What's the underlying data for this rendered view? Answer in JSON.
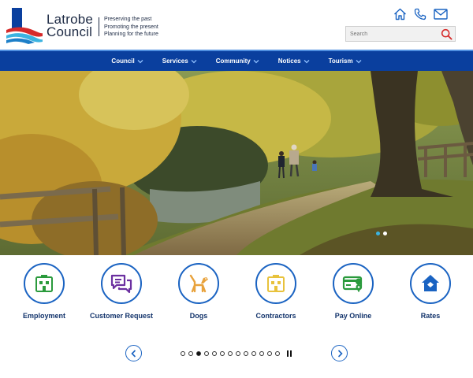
{
  "brand": {
    "name_line1": "Latrobe",
    "name_line2": "Council",
    "tagline": [
      "Preserving the past",
      "Promoting the present",
      "Planning for the future"
    ]
  },
  "utility": {
    "icons": [
      "home-icon",
      "phone-icon",
      "mail-icon"
    ]
  },
  "search": {
    "placeholder": "Search",
    "button_icon": "search-icon"
  },
  "nav": {
    "items": [
      {
        "label": "Council"
      },
      {
        "label": "Services"
      },
      {
        "label": "Community"
      },
      {
        "label": "Notices"
      },
      {
        "label": "Tourism"
      }
    ]
  },
  "hero": {
    "slides_total": 2,
    "active_slide": 1
  },
  "quicklinks": {
    "items": [
      {
        "label": "Employment",
        "icon": "building-icon",
        "color": "#2a9a3c"
      },
      {
        "label": "Customer Request",
        "icon": "chat-icon",
        "color": "#6b2fa0"
      },
      {
        "label": "Dogs",
        "icon": "dog-icon",
        "color": "#e8a23c"
      },
      {
        "label": "Contractors",
        "icon": "building-icon",
        "color": "#e8c23c"
      },
      {
        "label": "Pay Online",
        "icon": "credit-card-icon",
        "color": "#2a9a3c"
      },
      {
        "label": "Rates",
        "icon": "house-icon",
        "color": "#1a63c2"
      }
    ]
  },
  "carousel": {
    "page_count": 13,
    "active_page": 3
  },
  "colors": {
    "brand_blue": "#0a3f9e",
    "accent_blue": "#1a63c2",
    "logo_red": "#d62a2a",
    "logo_cyan": "#3bb3e0"
  }
}
